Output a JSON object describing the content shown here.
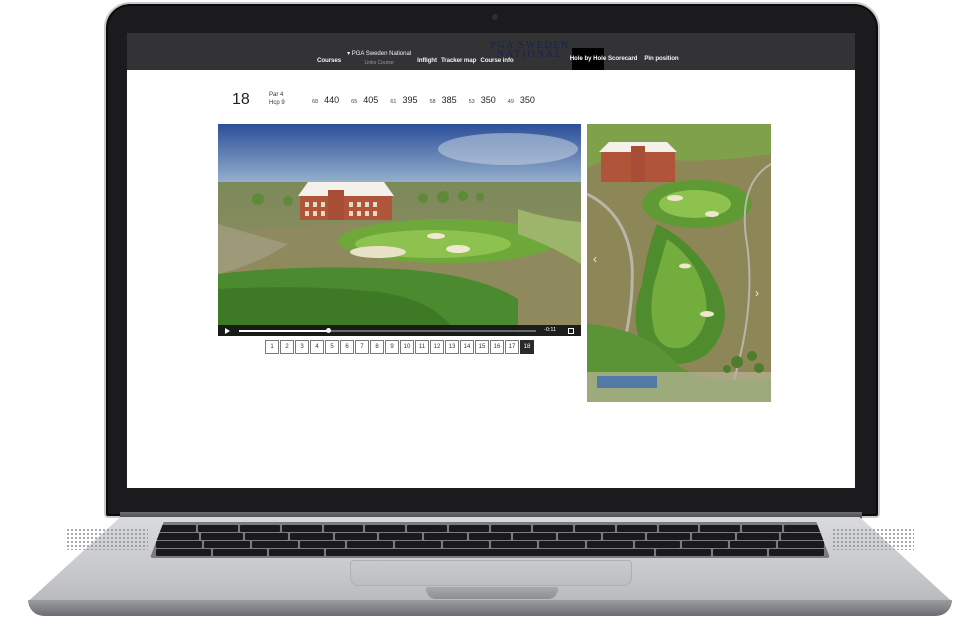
{
  "nav": {
    "courses": "Courses",
    "course_select": "PGA Sweden National",
    "course_sub": "Links Course",
    "inflight": "Inflight",
    "tracker_map": "Tracker map",
    "course_info": "Course info",
    "hole_by_hole": "Hole by Hole",
    "scorecard": "Scorecard",
    "pin_position": "Pin position"
  },
  "logo": {
    "line1": "PGA SWEDEN",
    "line2": "NATIONAL"
  },
  "hole": {
    "number": "18",
    "par": "Par 4",
    "hcp": "Hcp 9",
    "tees": [
      {
        "hcp": "68",
        "length": "440"
      },
      {
        "hcp": "65",
        "length": "405"
      },
      {
        "hcp": "61",
        "length": "395"
      },
      {
        "hcp": "58",
        "length": "385"
      },
      {
        "hcp": "53",
        "length": "350"
      },
      {
        "hcp": "49",
        "length": "350"
      }
    ]
  },
  "video": {
    "time_remaining": "-0:11",
    "progress_fraction": 0.3
  },
  "holes": [
    "1",
    "2",
    "3",
    "4",
    "5",
    "6",
    "7",
    "8",
    "9",
    "10",
    "11",
    "12",
    "13",
    "14",
    "15",
    "16",
    "17",
    "18"
  ],
  "active_hole": "18",
  "colors": {
    "header_bg": "#333336",
    "active_bg": "#000000",
    "logo": "#15234c",
    "fairway": "#6fa83a"
  }
}
